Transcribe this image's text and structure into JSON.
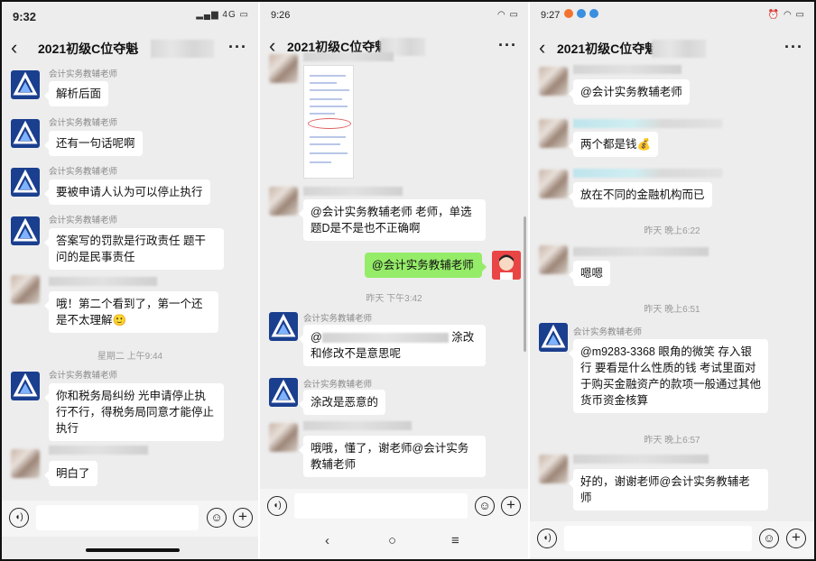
{
  "panel1": {
    "status_time": "9:32",
    "status_icons": "▂▄▆ 4G ▭",
    "title": "2021初级C位夺魁",
    "back_icon": "‹",
    "more_icon": "···",
    "messages": [
      {
        "sender": "会计实务教辅老师",
        "text": "解析后面"
      },
      {
        "sender": "会计实务教辅老师",
        "text": "还有一句话呢啊"
      },
      {
        "sender": "会计实务教辅老师",
        "text": "要被申请人认为可以停止执行"
      },
      {
        "sender": "会计实务教辅老师",
        "text": "答案写的罚款是行政责任  题干问的是民事责任"
      },
      {
        "sender": "",
        "text": "哦！第二个看到了，第一个还是不太理解🙂"
      },
      {
        "sender": "会计实务教辅老师",
        "text": "你和税务局纠纷  光申请停止执行不行，得税务局同意才能停止执行"
      },
      {
        "sender": "",
        "text": "明白了"
      }
    ],
    "timestamp": "星期二 上午9:44"
  },
  "panel2": {
    "status_time": "9:26",
    "status_icons": "◠ ▭",
    "title": "2021初级C位夺魁",
    "back_icon": "‹",
    "more_icon": "···",
    "messages": [
      {
        "sender": "",
        "text": "@会计实务教辅老师  老师，单选题D是不是也不正确啊"
      },
      {
        "sender": "",
        "text": "@会计实务教辅老师"
      },
      {
        "sender": "会计实务教辅老师",
        "text_a": "@",
        "text_b": "涂改和修改不是意思呢"
      },
      {
        "sender": "会计实务教辅老师",
        "text": "涂改是恶意的"
      },
      {
        "sender": "",
        "text": "哦哦，懂了，谢老师@会计实务教辅老师"
      }
    ],
    "timestamp": "昨天 下午3:42",
    "nav": {
      "back": "‹",
      "home": "○",
      "recent": "≡"
    }
  },
  "panel3": {
    "status_time": "9:27",
    "status_icons": "⏰ ◠ ▭",
    "title": "2021初级C位夺魁",
    "back_icon": "‹",
    "more_icon": "···",
    "messages": [
      {
        "sender": "",
        "text": "@会计实务教辅老师"
      },
      {
        "sender": "",
        "text": "两个都是钱💰"
      },
      {
        "sender": "",
        "text": "放在不同的金融机构而已"
      },
      {
        "sender": "",
        "text": "嗯嗯"
      },
      {
        "sender": "会计实务教辅老师",
        "text": "@m9283-3368  眼角的微笑  存入银行  要看是什么性质的钱  考试里面对于购买金融资产的款项一般通过其他货币资金核算"
      },
      {
        "sender": "",
        "text": "好的，谢谢老师@会计实务教辅老师"
      }
    ],
    "timestamps": [
      "昨天 晚上6:22",
      "昨天 晚上6:51",
      "昨天 晚上6:57"
    ]
  },
  "input": {
    "voice_icon": "◖)",
    "emoji_icon": "☺",
    "plus_icon": "+"
  },
  "colors": {
    "bg": "#ededed",
    "bubble": "#ffffff",
    "self_bubble": "#95ec69",
    "teacher_avatar": "#1b3f8f"
  }
}
